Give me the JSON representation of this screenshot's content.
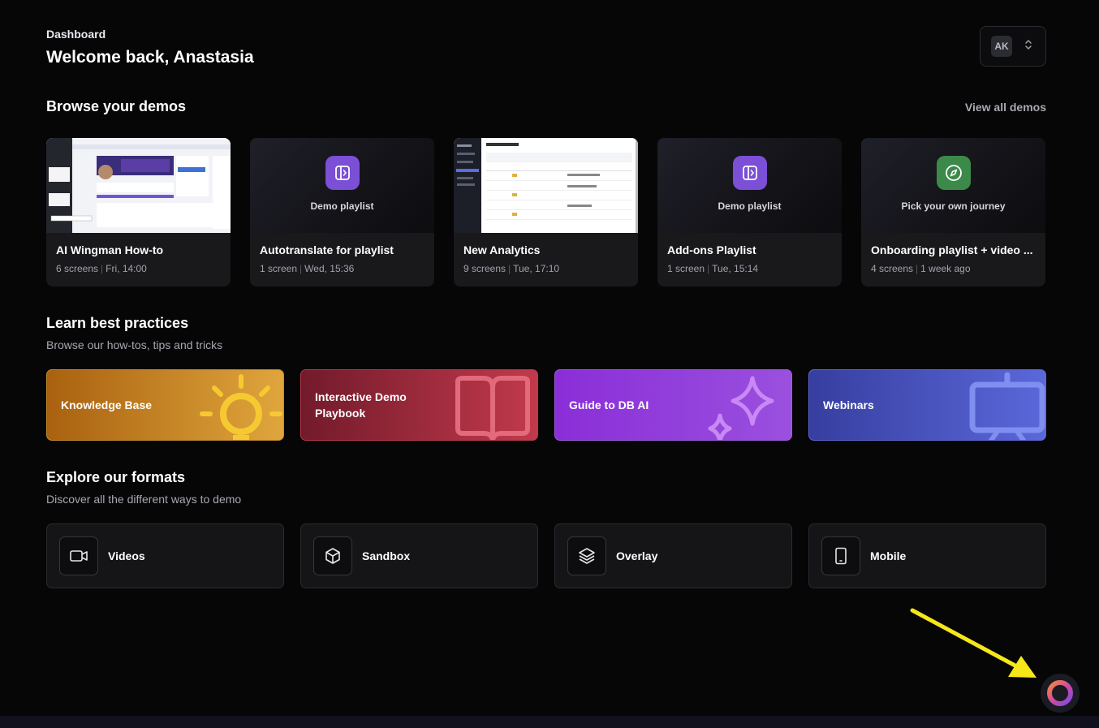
{
  "header": {
    "breadcrumb": "Dashboard",
    "welcome": "Welcome back, Anastasia",
    "account_initials": "AK"
  },
  "demos": {
    "title": "Browse your demos",
    "view_all": "View all demos",
    "items": [
      {
        "title": "AI Wingman How-to",
        "count": "6 screens",
        "time": "Fri, 14:00",
        "thumb": "screenshot"
      },
      {
        "title": "Autotranslate for playlist",
        "count": "1 screen",
        "time": "Wed, 15:36",
        "thumb": "playlist-icon",
        "thumb_label": "Demo playlist",
        "icon_color": "#7b4fd6"
      },
      {
        "title": "New Analytics",
        "count": "9 screens",
        "time": "Tue, 17:10",
        "thumb": "screenshot"
      },
      {
        "title": "Add-ons Playlist",
        "count": "1 screen",
        "time": "Tue, 15:14",
        "thumb": "playlist-icon",
        "thumb_label": "Demo playlist",
        "icon_color": "#7b4fd6"
      },
      {
        "title": "Onboarding playlist + video ...",
        "count": "4 screens",
        "time": "1 week ago",
        "thumb": "compass-icon",
        "thumb_label": "Pick your own journey",
        "icon_color": "#3c8a4a"
      }
    ]
  },
  "practices": {
    "title": "Learn best practices",
    "subtitle": "Browse our how-tos, tips and tricks",
    "items": [
      {
        "label": "Knowledge Base",
        "icon": "sun-icon",
        "from": "#b06a14",
        "to": "#e1a53c"
      },
      {
        "label": "Interactive Demo Playbook",
        "icon": "book-icon",
        "from": "#7a1e30",
        "to": "#c33a4e"
      },
      {
        "label": "Guide to DB AI",
        "icon": "sparkle-icon",
        "from": "#8a2fd6",
        "to": "#9b52e0"
      },
      {
        "label": "Webinars",
        "icon": "presentation-icon",
        "from": "#3a40a8",
        "to": "#5a66d8"
      }
    ]
  },
  "formats": {
    "title": "Explore our formats",
    "subtitle": "Discover all the different ways to demo",
    "items": [
      {
        "label": "Videos",
        "icon": "video-camera-icon"
      },
      {
        "label": "Sandbox",
        "icon": "cube-icon"
      },
      {
        "label": "Overlay",
        "icon": "layers-icon"
      },
      {
        "label": "Mobile",
        "icon": "mobile-icon"
      }
    ]
  },
  "colors": {
    "background": "#060607",
    "card": "#19191c",
    "annotation_arrow": "#f5e71a"
  }
}
